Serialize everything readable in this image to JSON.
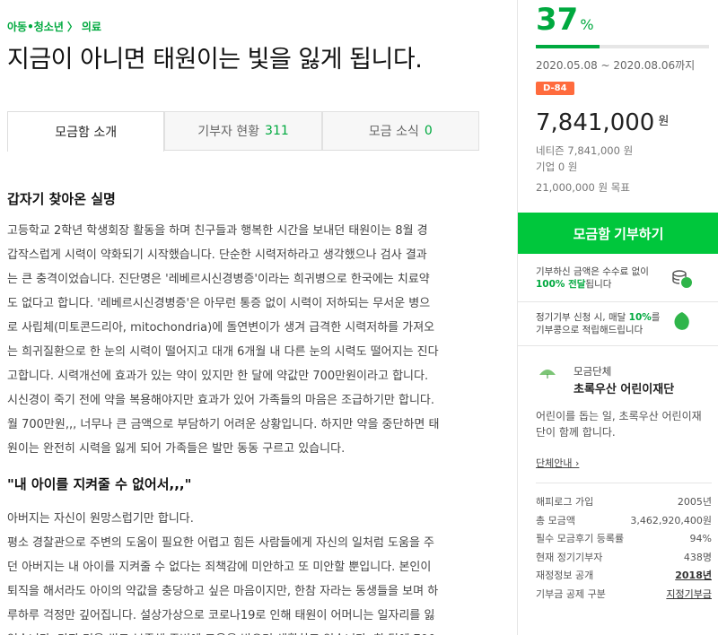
{
  "breadcrumb": {
    "category": "아동•청소년",
    "separator": "〉",
    "subcategory": "의료"
  },
  "title": "지금이 아니면 태원이는 빛을 잃게 됩니다.",
  "tabs": [
    {
      "label": "모금함 소개",
      "count": "",
      "active": true
    },
    {
      "label": "기부자 현황",
      "count": "311",
      "active": false
    },
    {
      "label": "모금 소식",
      "count": "0",
      "active": false
    }
  ],
  "sections": [
    {
      "heading": "갑자기 찾아온 실명",
      "lines": [
        "고등학교 2학년 학생회장 활동을 하며 친구들과 행복한 시간을 보내던 태원이는 8월 경",
        "갑작스럽게 시력이 약화되기 시작했습니다. 단순한 시력저하라고 생각했으나 검사 결과",
        "는 큰 충격이었습니다. 진단명은 '레베르시신경병증'이라는 희귀병으로 한국에는 치료약",
        "도 없다고 합니다. '레베르시신경병증'은 아무런 통증 없이 시력이 저하되는 무서운 병으",
        "로 사립체(미토콘드리아, mitochondria)에 돌연변이가 생겨 급격한 시력저하를 가져오",
        "는 희귀질환으로 한 눈의 시력이 떨어지고 대개 6개월 내 다른 눈의 시력도 떨어지는 진다",
        "고합니다. 시력개선에 효과가 있는 약이 있지만 한 달에 약값만 700만원이라고 합니다.",
        "시신경이 죽기 전에 약을 복용해야지만 효과가 있어 가족들의 마음은 조급하기만 합니다.",
        "월 700만원,,, 너무나 큰 금액으로 부담하기 어려운 상황입니다. 하지만 약을 중단하면 태",
        "원이는 완전히 시력을 잃게 되어 가족들은 발만 동동 구르고 있습니다."
      ]
    },
    {
      "heading": "\"내 아이를 지켜줄 수 없어서,,,\"",
      "lines": [
        "아버지는 자신이 원망스럽기만 합니다.",
        "평소 경찰관으로 주변의 도움이 필요한 어렵고 힘든 사람들에게 자신의 일처럼 도움을 주",
        "던 아버지는 내 아이를 지켜줄 수 없다는 죄책감에 미안하고 또 미안할 뿐입니다. 본인이",
        "퇴직을 해서라도 아이의 약값을 충당하고 싶은 마음이지만, 한참 자라는 동생들을 보며 하",
        "루하루 걱정만 깊어집니다. 설상가상으로 코로나19로 인해 태원이 어머니는 일자리를 잃",
        "었습니다. 당장 먹을 쌀도 부족해 주변에 도움을 받으며 생활하고 있습니다. 한 달에 700"
      ]
    }
  ],
  "summary": {
    "percent": "37",
    "percent_unit": "%",
    "progress_ratio": 0.37,
    "period": "2020.05.08 ~ 2020.08.06까지",
    "dday": "D-84",
    "amount": "7,841,000",
    "amount_unit": "원",
    "netizen": "네티즌 7,841,000 원",
    "company": "기업 0 원",
    "goal": "21,000,000 원 목표"
  },
  "donate_button": "모금함 기부하기",
  "notices": [
    {
      "pre": "기부하신 금액은 수수료 없이",
      "bold": "100% 전달",
      "post": "됩니다",
      "icon": "coins-icon"
    },
    {
      "pre": "정기기부 신청 시, 매달",
      "bold": "10%",
      "post": "를 기부콩으로 적립해드립니다",
      "icon": "bean-icon"
    }
  ],
  "organization": {
    "logo_text": "초록우산 어린이재단",
    "label": "모금단체",
    "name": "초록우산 어린이재단",
    "description": "어린이를 돕는 일, 초록우산 어린이재단이 함께 합니다.",
    "link": "단체안내 ›",
    "stats": [
      {
        "label": "해피로그 가입",
        "value": "2005년"
      },
      {
        "label": "총 모금액",
        "value": "3,462,920,400원"
      },
      {
        "label": "필수 모금후기 등록률",
        "value": "94%"
      },
      {
        "label": "현재 정기기부자",
        "value": "438명"
      },
      {
        "label": "재정정보 공개",
        "value": "2018년"
      },
      {
        "label": "기부금 공제 구분",
        "value": "지정기부금"
      }
    ]
  },
  "colors": {
    "accent": "#00a93f",
    "button": "#00c73c",
    "dday": "#ff6b3d"
  }
}
